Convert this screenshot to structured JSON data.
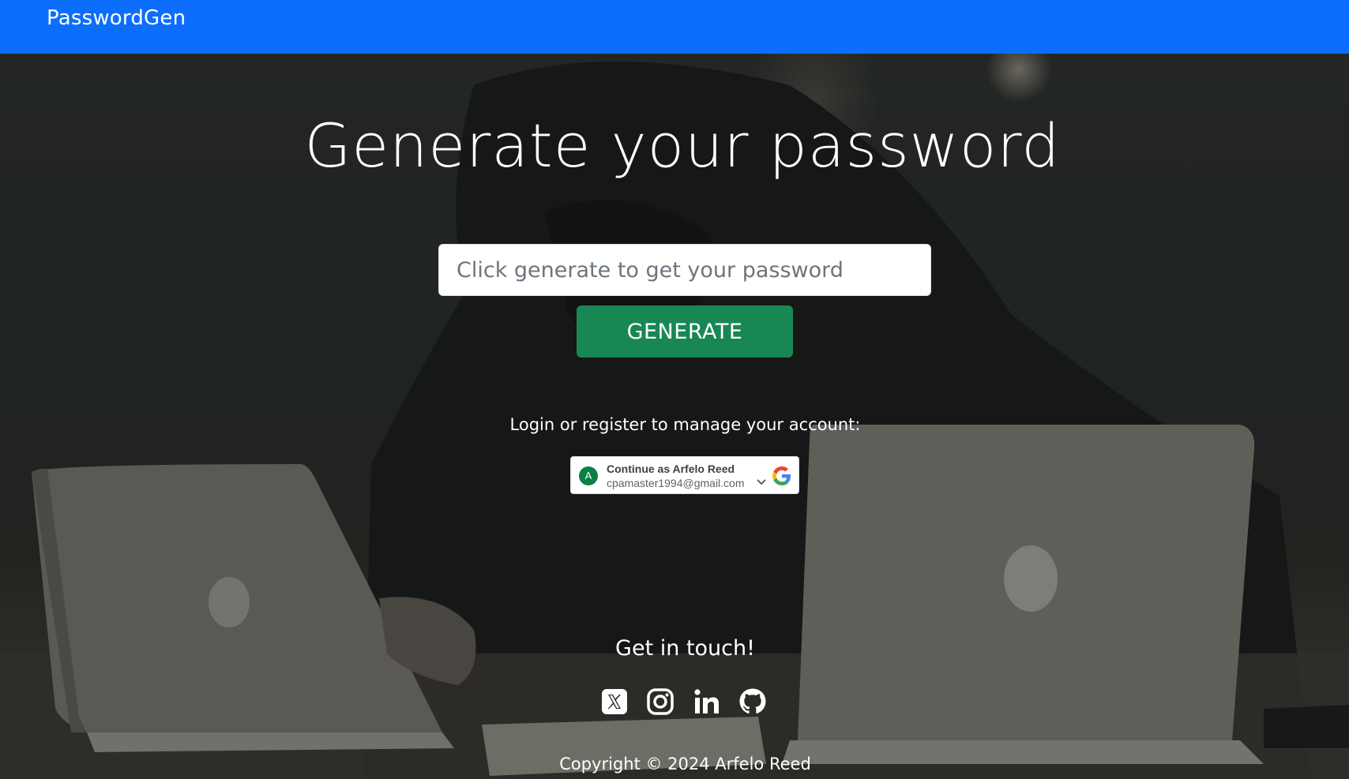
{
  "navbar": {
    "brand": "PasswordGen"
  },
  "hero": {
    "title": "Generate your password",
    "input_placeholder": "Click generate to get your password",
    "generate_label": "GENERATE",
    "login_prompt": "Login or register to manage your account:"
  },
  "google_signin": {
    "avatar_letter": "A",
    "title": "Continue as Arfelo Reed",
    "email": "cpamaster1994@gmail.com"
  },
  "footer": {
    "touch_title": "Get in touch!",
    "socials": [
      "x-icon",
      "instagram-icon",
      "linkedin-icon",
      "github-icon"
    ],
    "copyright": "Copyright © 2024 Arfelo Reed"
  },
  "colors": {
    "navbar": "#0d6efd",
    "generate_button": "#198754"
  }
}
